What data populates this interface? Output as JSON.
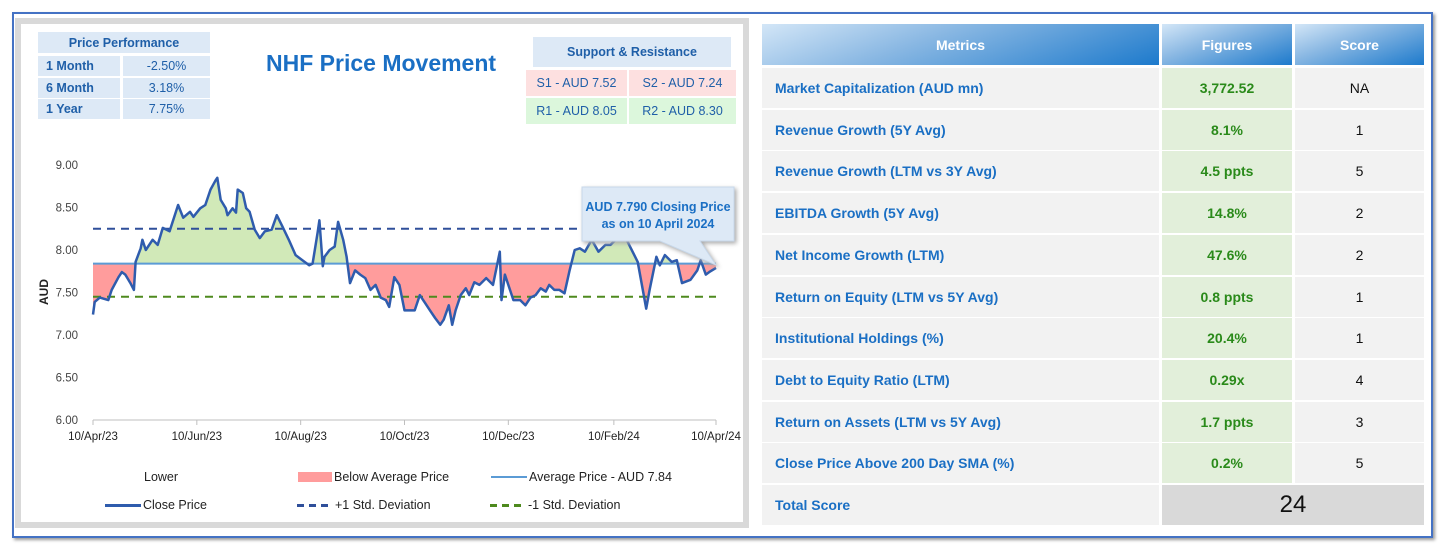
{
  "chart_data": {
    "type": "line",
    "title": "NHF Price Movement",
    "ylabel": "AUD",
    "xlabel": "",
    "ylim": [
      6.0,
      9.0
    ],
    "yticks": [
      "6.00",
      "6.50",
      "7.00",
      "7.50",
      "8.00",
      "8.50",
      "9.00"
    ],
    "xticks": [
      {
        "label": "10/Apr/23",
        "day": 0
      },
      {
        "label": "10/Jun/23",
        "day": 61
      },
      {
        "label": "10/Aug/23",
        "day": 122
      },
      {
        "label": "10/Oct/23",
        "day": 183
      },
      {
        "label": "10/Dec/23",
        "day": 244
      },
      {
        "label": "10/Feb/24",
        "day": 306
      },
      {
        "label": "10/Apr/24",
        "day": 366
      }
    ],
    "xrange_days": [
      0,
      366
    ],
    "average_price": 7.84,
    "plus_1_std": 8.25,
    "minus_1_std": 7.45,
    "close_price": [
      [
        0,
        7.24
      ],
      [
        1,
        7.39
      ],
      [
        4,
        7.44
      ],
      [
        9,
        7.41
      ],
      [
        11,
        7.53
      ],
      [
        15,
        7.68
      ],
      [
        17,
        7.74
      ],
      [
        19,
        7.71
      ],
      [
        22,
        7.61
      ],
      [
        24,
        7.53
      ],
      [
        25,
        7.86
      ],
      [
        28,
        8.02
      ],
      [
        29,
        8.12
      ],
      [
        31,
        8.0
      ],
      [
        35,
        8.12
      ],
      [
        38,
        8.06
      ],
      [
        41,
        8.26
      ],
      [
        45,
        8.22
      ],
      [
        50,
        8.53
      ],
      [
        53,
        8.38
      ],
      [
        57,
        8.45
      ],
      [
        59,
        8.39
      ],
      [
        63,
        8.49
      ],
      [
        66,
        8.53
      ],
      [
        69,
        8.71
      ],
      [
        72,
        8.82
      ],
      [
        73,
        8.85
      ],
      [
        75,
        8.59
      ],
      [
        78,
        8.49
      ],
      [
        79,
        8.41
      ],
      [
        82,
        8.49
      ],
      [
        84,
        8.44
      ],
      [
        85,
        8.71
      ],
      [
        88,
        8.67
      ],
      [
        90,
        8.49
      ],
      [
        92,
        8.45
      ],
      [
        95,
        8.24
      ],
      [
        98,
        8.14
      ],
      [
        101,
        8.22
      ],
      [
        105,
        8.24
      ],
      [
        108,
        8.41
      ],
      [
        111,
        8.29
      ],
      [
        115,
        8.12
      ],
      [
        119,
        7.94
      ],
      [
        123,
        7.88
      ],
      [
        127,
        7.82
      ],
      [
        129,
        7.84
      ],
      [
        132,
        8.21
      ],
      [
        133,
        8.35
      ],
      [
        135,
        7.81
      ],
      [
        136,
        7.92
      ],
      [
        139,
        8.0
      ],
      [
        142,
        8.04
      ],
      [
        144,
        8.33
      ],
      [
        147,
        8.12
      ],
      [
        149,
        7.92
      ],
      [
        151,
        7.61
      ],
      [
        154,
        7.76
      ],
      [
        157,
        7.71
      ],
      [
        160,
        7.67
      ],
      [
        163,
        7.53
      ],
      [
        166,
        7.59
      ],
      [
        169,
        7.44
      ],
      [
        172,
        7.41
      ],
      [
        174,
        7.33
      ],
      [
        177,
        7.68
      ],
      [
        180,
        7.59
      ],
      [
        183,
        7.29
      ],
      [
        186,
        7.29
      ],
      [
        189,
        7.29
      ],
      [
        192,
        7.47
      ],
      [
        195,
        7.38
      ],
      [
        198,
        7.29
      ],
      [
        201,
        7.2
      ],
      [
        204,
        7.12
      ],
      [
        206,
        7.18
      ],
      [
        209,
        7.35
      ],
      [
        211,
        7.12
      ],
      [
        213,
        7.29
      ],
      [
        216,
        7.47
      ],
      [
        219,
        7.55
      ],
      [
        221,
        7.47
      ],
      [
        224,
        7.62
      ],
      [
        227,
        7.59
      ],
      [
        231,
        7.67
      ],
      [
        235,
        7.59
      ],
      [
        239,
        7.98
      ],
      [
        240,
        7.41
      ],
      [
        242,
        7.71
      ],
      [
        245,
        7.53
      ],
      [
        247,
        7.41
      ],
      [
        251,
        7.41
      ],
      [
        254,
        7.35
      ],
      [
        257,
        7.44
      ],
      [
        260,
        7.47
      ],
      [
        263,
        7.55
      ],
      [
        266,
        7.51
      ],
      [
        268,
        7.59
      ],
      [
        271,
        7.53
      ],
      [
        274,
        7.53
      ],
      [
        277,
        7.49
      ],
      [
        280,
        7.76
      ],
      [
        283,
        8.0
      ],
      [
        286,
        8.02
      ],
      [
        289,
        7.98
      ],
      [
        293,
        8.12
      ],
      [
        297,
        7.98
      ],
      [
        301,
        8.06
      ],
      [
        304,
        8.06
      ],
      [
        307,
        8.12
      ],
      [
        313,
        8.14
      ],
      [
        315,
        8.06
      ],
      [
        320,
        7.86
      ],
      [
        323,
        7.53
      ],
      [
        325,
        7.31
      ],
      [
        327,
        7.53
      ],
      [
        331,
        7.92
      ],
      [
        333,
        7.82
      ],
      [
        336,
        7.94
      ],
      [
        340,
        7.86
      ],
      [
        343,
        7.88
      ],
      [
        346,
        7.61
      ],
      [
        351,
        7.65
      ],
      [
        355,
        7.76
      ],
      [
        357,
        7.88
      ],
      [
        360,
        7.71
      ],
      [
        362,
        7.74
      ],
      [
        366,
        7.79
      ]
    ],
    "callout": "AUD 7.790 Closing Price as on 10 April 2024",
    "callout_line1": "AUD 7.790 Closing Price",
    "callout_line2": "as on 10 April 2024",
    "legend": {
      "lower": "Lower",
      "below": "Below Average Price",
      "average": "Average Price - AUD 7.84",
      "close": "Close Price",
      "plus_std": "+1 Std. Deviation",
      "minus_std": "-1 Std. Deviation"
    },
    "colors": {
      "close": "#2f5cad",
      "average": "#5b9bd5",
      "plus_std": "#2f4f9a",
      "minus_std": "#4e8a1e",
      "above_fill": "#d1e9b8",
      "below_fill": "#ff9c9c"
    }
  },
  "price_performance": {
    "title": "Price Performance",
    "rows": [
      {
        "label": "1 Month",
        "value": "-2.50%"
      },
      {
        "label": "6 Month",
        "value": "3.18%"
      },
      {
        "label": "1 Year",
        "value": "7.75%"
      }
    ]
  },
  "support_resistance": {
    "title": "Support & Resistance",
    "s1": "S1 - AUD 7.52",
    "s2": "S2 - AUD 7.24",
    "r1": "R1 - AUD 8.05",
    "r2": "R2 - AUD 8.30"
  },
  "metrics_table": {
    "headers": [
      "Metrics",
      "Figures",
      "Score"
    ],
    "rows": [
      {
        "metric": "Market Capitalization (AUD mn)",
        "figure": "3,772.52",
        "score": "NA"
      },
      {
        "metric": "Revenue Growth (5Y Avg)",
        "figure": "8.1%",
        "score": "1"
      },
      {
        "metric": "Revenue Growth (LTM vs 3Y Avg)",
        "figure": "4.5 ppts",
        "score": "5"
      },
      {
        "metric": "EBITDA Growth (5Y Avg)",
        "figure": "14.8%",
        "score": "2"
      },
      {
        "metric": "Net Income Growth (LTM)",
        "figure": "47.6%",
        "score": "2"
      },
      {
        "metric": "Return on Equity (LTM vs 5Y Avg)",
        "figure": "0.8 ppts",
        "score": "1"
      },
      {
        "metric": "Institutional Holdings (%)",
        "figure": "20.4%",
        "score": "1"
      },
      {
        "metric": "Debt to Equity Ratio (LTM)",
        "figure": "0.29x",
        "score": "4"
      },
      {
        "metric": "Return on Assets (LTM vs 5Y Avg)",
        "figure": "1.7 ppts",
        "score": "3"
      },
      {
        "metric": "Close Price Above 200 Day SMA (%)",
        "figure": "0.2%",
        "score": "5"
      }
    ],
    "total_label": "Total Score",
    "total_value": "24"
  }
}
